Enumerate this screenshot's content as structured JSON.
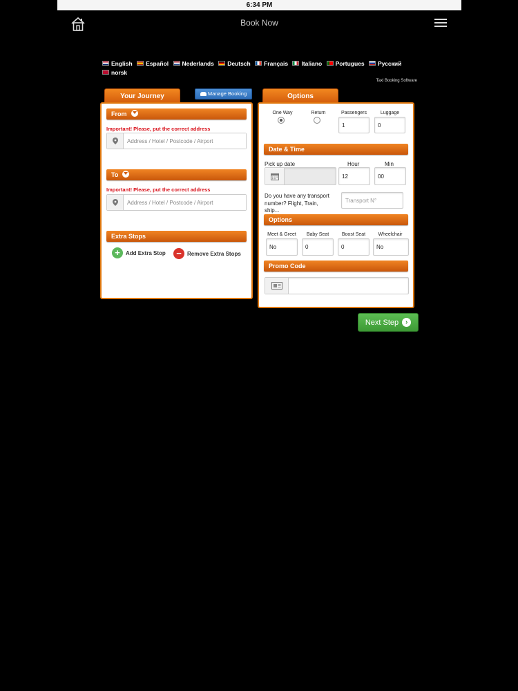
{
  "status_bar": {
    "time": "6:34 PM"
  },
  "header": {
    "title": "Book Now",
    "home_icon": "home-icon",
    "menu_icon": "hamburger-menu-icon"
  },
  "languages": [
    {
      "label": "English",
      "flag": "uk"
    },
    {
      "label": "Español",
      "flag": "spain"
    },
    {
      "label": "Nederlands",
      "flag": "netherlands"
    },
    {
      "label": "Deutsch",
      "flag": "germany"
    },
    {
      "label": "Français",
      "flag": "france"
    },
    {
      "label": "Italiano",
      "flag": "italy"
    },
    {
      "label": "Portugues",
      "flag": "portugal"
    },
    {
      "label": "Русский",
      "flag": "russia"
    },
    {
      "label": "norsk",
      "flag": "norway"
    }
  ],
  "tagline": "Taxi Booking Software",
  "tabs": {
    "journey": "Your Journey",
    "options": "Options"
  },
  "manage_booking": "Manage Booking",
  "journey": {
    "from_title": "From",
    "to_title": "To",
    "warning": "Important! Please, put the correct address",
    "address_placeholder": "Address / Hotel / Postcode / Airport",
    "extra_stops_title": "Extra Stops",
    "add_extra_stop": "Add Extra Stop",
    "remove_extra_stops": "Remove Extra Stops"
  },
  "options": {
    "one_way": "One Way",
    "return": "Return",
    "trip_type_selected": "One Way",
    "passengers_label": "Passengers",
    "passengers": "1",
    "luggage_label": "Luggage",
    "luggage": "0",
    "date_time_title": "Date & Time",
    "pickup_label": "Pick up date",
    "pickup_value": "",
    "hour_label": "Hour",
    "hour": "12",
    "min_label": "Min",
    "min": "00",
    "transport_question": "Do you have any transport number? Flight, Train, ship...",
    "transport_placeholder": "Transport N°",
    "options_title": "Options",
    "meet_greet_label": "Meet & Greet",
    "meet_greet": "No",
    "baby_seat_label": "Baby Seat",
    "baby_seat": "0",
    "boost_seat_label": "Boost Seat",
    "boost_seat": "0",
    "wheelchair_label": "Wheelchair",
    "wheelchair": "No",
    "promo_title": "Promo Code",
    "promo_value": ""
  },
  "next_step": "Next Step",
  "colors": {
    "accent": "#e0780f",
    "warning": "#d9121b",
    "next": "#4aa842",
    "manage": "#3a7fc8"
  }
}
